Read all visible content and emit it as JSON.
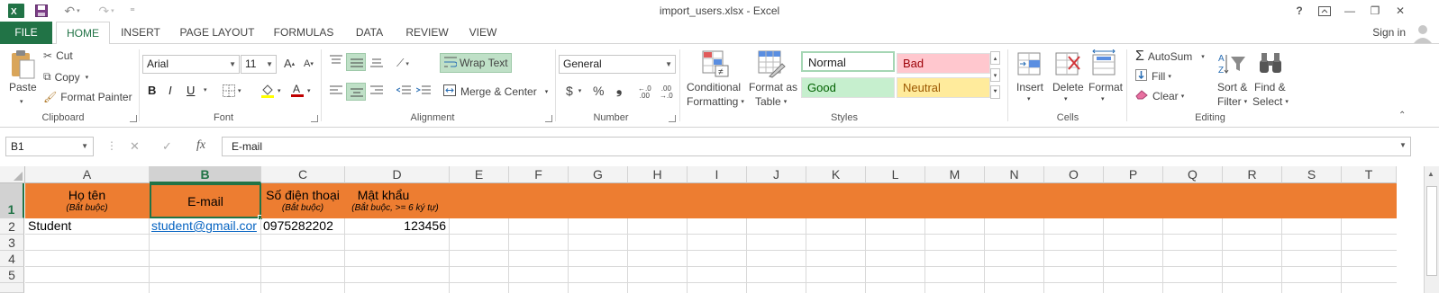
{
  "window": {
    "title": "import_users.xlsx - Excel",
    "help": "?",
    "minimize": "—",
    "restore": "❐",
    "close": "✕"
  },
  "quick_access": {
    "more": "⁼"
  },
  "tabs": [
    "FILE",
    "HOME",
    "INSERT",
    "PAGE LAYOUT",
    "FORMULAS",
    "DATA",
    "REVIEW",
    "VIEW"
  ],
  "signin": "Sign in",
  "ribbon": {
    "clipboard": {
      "label": "Clipboard",
      "paste": "Paste",
      "cut": "Cut",
      "copy": "Copy",
      "format_painter": "Format Painter"
    },
    "font": {
      "label": "Font",
      "font_name": "Arial",
      "font_size": "11",
      "bold": "B",
      "italic": "I",
      "underline": "U"
    },
    "alignment": {
      "label": "Alignment",
      "wrap_text": "Wrap Text",
      "merge_center": "Merge & Center"
    },
    "number": {
      "label": "Number",
      "format": "General",
      "currency": "$",
      "percent": "%",
      "comma": "❟"
    },
    "styles": {
      "label": "Styles",
      "conditional_1": "Conditional",
      "conditional_2": "Formatting",
      "format_as_1": "Format as",
      "format_as_2": "Table",
      "normal": "Normal",
      "bad": "Bad",
      "good": "Good",
      "neutral": "Neutral"
    },
    "cells": {
      "label": "Cells",
      "insert": "Insert",
      "delete": "Delete",
      "format": "Format"
    },
    "editing": {
      "label": "Editing",
      "autosum": "AutoSum",
      "fill": "Fill",
      "clear": "Clear",
      "sort_1": "Sort &",
      "sort_2": "Filter",
      "find_1": "Find &",
      "find_2": "Select"
    }
  },
  "formula_bar": {
    "name_box": "B1",
    "fx": "fx",
    "value": "E-mail"
  },
  "columns": [
    "A",
    "B",
    "C",
    "D",
    "E",
    "F",
    "G",
    "H",
    "I",
    "J",
    "K",
    "L",
    "M",
    "N",
    "O",
    "P",
    "Q",
    "R",
    "S",
    "T"
  ],
  "rows": [
    "1",
    "2",
    "3",
    "4",
    "5"
  ],
  "sheet": {
    "header": [
      {
        "main": "Họ tên",
        "sub": "(Bắt buộc)"
      },
      {
        "main": "E-mail",
        "sub": ""
      },
      {
        "main": "Số điện thoại",
        "sub": "(Bắt buộc)"
      },
      {
        "main": "Mật khẩu",
        "sub": "(Bắt buộc, >= 6 ký tự)"
      }
    ],
    "row2": {
      "name": "Student",
      "email": "student@gmail.cor",
      "phone": "0975282202",
      "password": "123456"
    }
  },
  "colors": {
    "excel_green": "#217346",
    "header_orange": "#ed7d31",
    "selection_green": "#217346"
  }
}
